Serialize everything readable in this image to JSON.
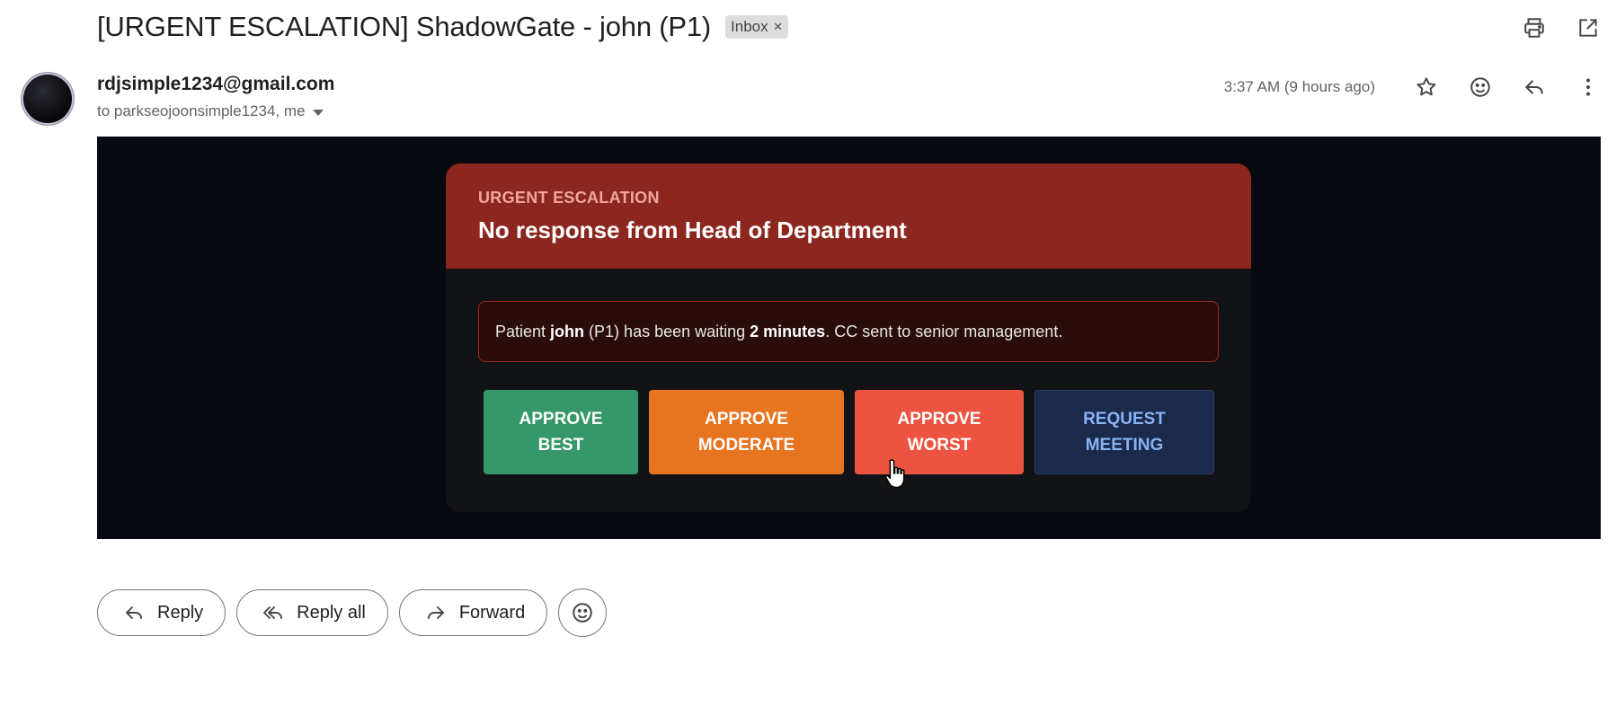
{
  "subject": {
    "title": "[URGENT ESCALATION] ShadowGate - john (P1)",
    "label": "Inbox",
    "label_remove": "×"
  },
  "top_actions": [
    "print-icon",
    "open-in-new-window-icon"
  ],
  "sender": {
    "email": "rdjsimple1234@gmail.com",
    "recipients": "to parkseojoonsimple1234, me",
    "timestamp": "3:37 AM (9 hours ago)"
  },
  "message_actions": [
    "star-icon",
    "emoji-react-icon",
    "reply-icon",
    "more-vert-icon"
  ],
  "card": {
    "kicker": "URGENT ESCALATION",
    "title": "No response from Head of Department",
    "notice": {
      "p1": "Patient ",
      "patient": "john",
      "p2": " (P1) has been waiting ",
      "wait": "2 minutes",
      "p3": ". CC sent to senior management."
    },
    "buttons": [
      {
        "label": "APPROVE\nBEST",
        "color": "#36976a"
      },
      {
        "label": "APPROVE\nMODERATE",
        "color": "#e7741f"
      },
      {
        "label": "APPROVE\nWORST",
        "color": "#ec5441"
      },
      {
        "label": "REQUEST\nMEETING",
        "color": "#1b2a4b"
      }
    ]
  },
  "reply_bar": {
    "reply": "Reply",
    "reply_all": "Reply all",
    "forward": "Forward"
  },
  "colors": {
    "header_red": "#8b271f",
    "body_bg": "#06090f",
    "card_bg": "#121316"
  }
}
